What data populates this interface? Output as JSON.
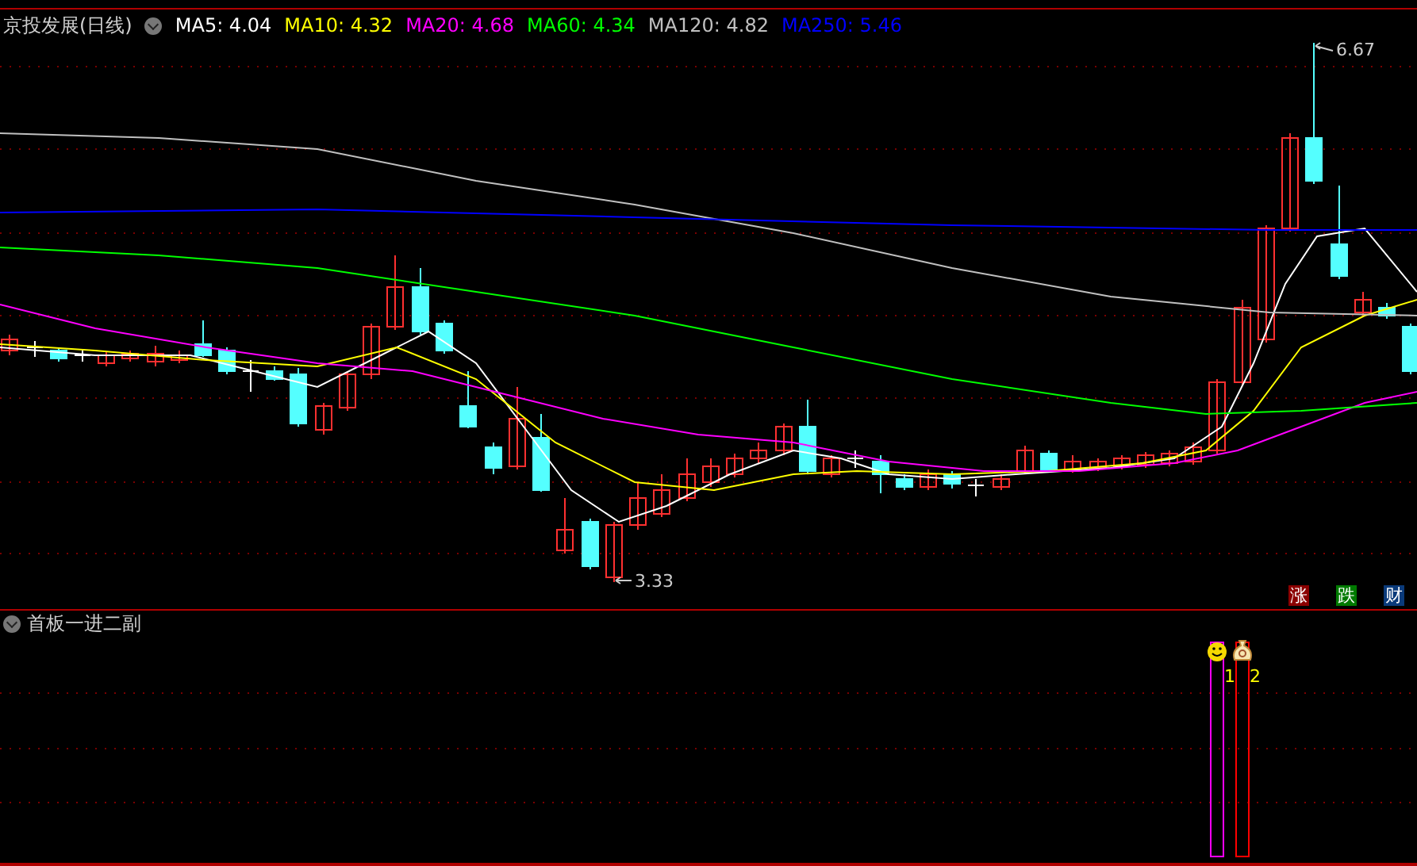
{
  "chart_header": {
    "title": "京投发展(日线)",
    "ma_lines": [
      {
        "label": "MA5: 4.04",
        "color": "#ffffff"
      },
      {
        "label": "MA10: 4.32",
        "color": "#ffff00"
      },
      {
        "label": "MA20: 4.68",
        "color": "#ff00ff"
      },
      {
        "label": "MA60: 4.34",
        "color": "#00ff00"
      },
      {
        "label": "MA120: 4.82",
        "color": "#c0c0c0"
      },
      {
        "label": "MA250: 5.46",
        "color": "#0000ff"
      }
    ]
  },
  "price_chart": {
    "high_label": "6.67",
    "low_label": "3.33",
    "badges": [
      {
        "text": "涨",
        "color": "#8b0000"
      },
      {
        "text": "跌",
        "color": "#007a00"
      },
      {
        "text": "财",
        "color": "#0a3a7a"
      }
    ]
  },
  "indicator": {
    "title": "首板一进二副",
    "signals": [
      {
        "label": "1",
        "kind": "smiley",
        "color": "#ff00ff"
      },
      {
        "label": "2",
        "kind": "money-bag",
        "color": "#ff0000"
      }
    ]
  }
}
